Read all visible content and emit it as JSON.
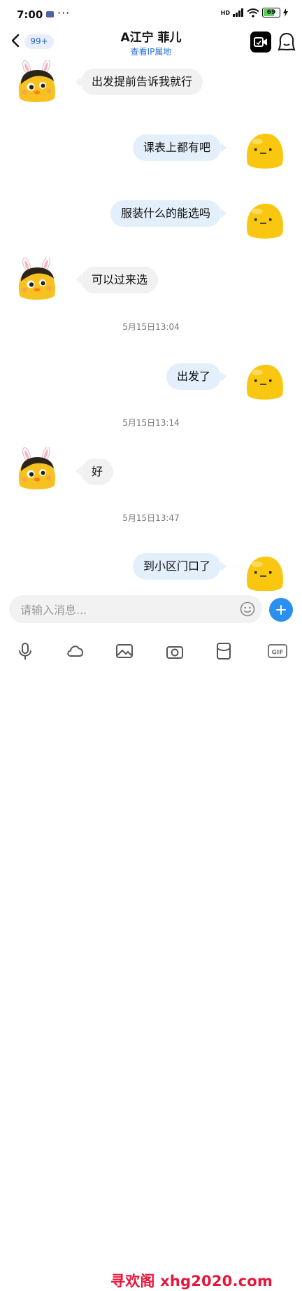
{
  "status_bar": {
    "time": "7:00",
    "dots": "···",
    "network": "HD",
    "battery": "69"
  },
  "header": {
    "badge": "99+",
    "title": "A江宁 菲儿",
    "subtitle": "查看IP属地",
    "icons": [
      "back-chevron",
      "video-call",
      "profile"
    ]
  },
  "messages": [
    {
      "side": "left",
      "text": "出发提前告诉我就行"
    },
    {
      "side": "right",
      "text": "课表上都有吧"
    },
    {
      "side": "right",
      "text": "服装什么的能选吗"
    },
    {
      "side": "left",
      "text": "可以过来选"
    },
    {
      "timestamp": "5月15日13:04"
    },
    {
      "side": "right",
      "text": "出发了"
    },
    {
      "timestamp": "5月15日13:14"
    },
    {
      "side": "left",
      "text": "好"
    },
    {
      "timestamp": "5月15日13:47"
    },
    {
      "side": "right",
      "text": "到小区门口了"
    }
  ],
  "input": {
    "placeholder": "请输入消息...",
    "value": ""
  },
  "toolbar": {
    "icons": [
      "mic",
      "cloud",
      "image",
      "camera",
      "red-packet",
      "gif"
    ]
  },
  "watermark": "寻欢阁 xhg2020.com",
  "colors": {
    "accent": "#2a8ff0",
    "bubble_self": "#e3f0fc",
    "bubble_other": "#f1f1f1",
    "link": "#2d73d8",
    "watermark": "#e8163b"
  }
}
